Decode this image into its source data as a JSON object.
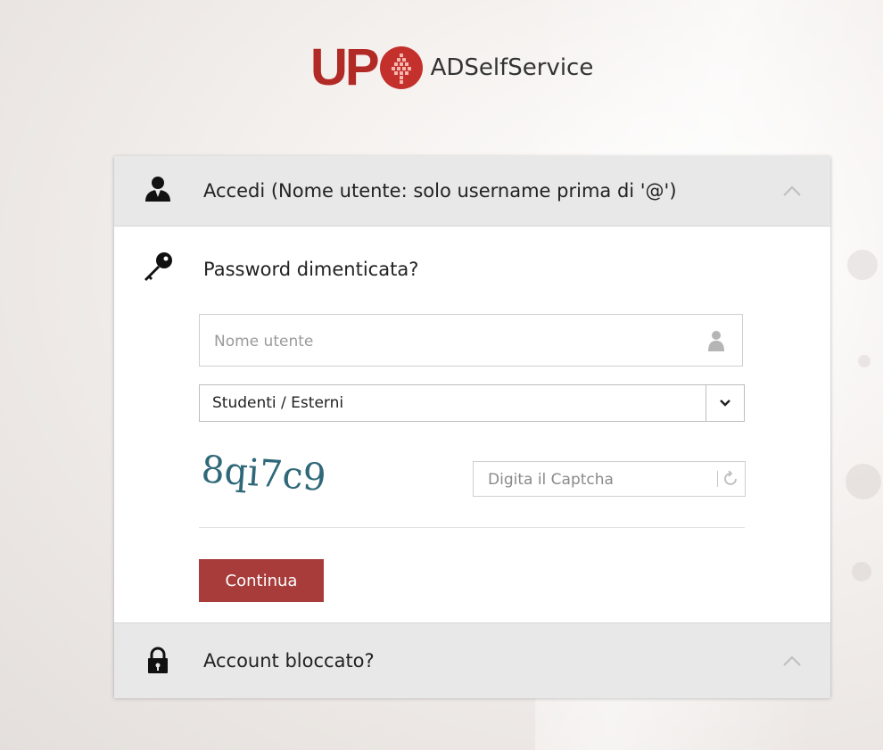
{
  "brand": {
    "logo_letters": "UP",
    "app_name": "ADSelfService",
    "logo_color": "#b22a26"
  },
  "login_section": {
    "title": "Accedi (Nome utente: solo username prima di '@')",
    "icon": "user-icon",
    "expanded": false
  },
  "forgot_password": {
    "title": "Password dimenticata?",
    "icon": "key-icon",
    "username_input": {
      "placeholder": "Nome utente",
      "value": ""
    },
    "domain_select": {
      "selected": "Studenti / Esterni"
    },
    "captcha": {
      "text": "8qi7c9",
      "input_placeholder": "Digita il Captcha",
      "value": ""
    },
    "continue_label": "Continua",
    "button_color": "#a73c3b"
  },
  "account_locked": {
    "title": "Account bloccato?",
    "icon": "lock-icon",
    "expanded": false
  }
}
